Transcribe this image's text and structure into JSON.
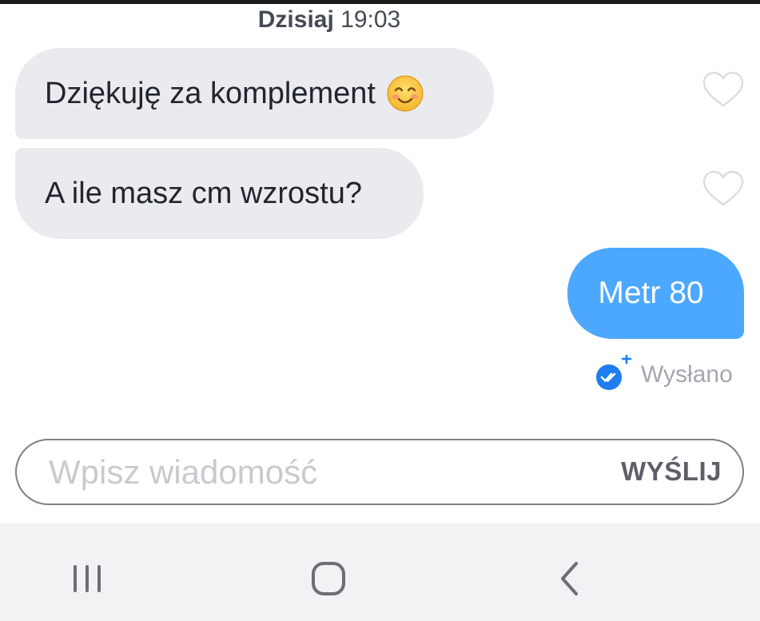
{
  "conversation": {
    "date_label": "Dzisiaj",
    "time_label": "19:03",
    "messages": [
      {
        "direction": "incoming",
        "text": "Dziękuję za komplement",
        "emoji": "smiling-face-icon",
        "liked": false
      },
      {
        "direction": "incoming",
        "text": "A ile masz cm wzrostu?",
        "liked": false
      },
      {
        "direction": "outgoing",
        "text": "Metr 80"
      }
    ],
    "status": {
      "text": "Wysłano",
      "icon": "double-check-icon"
    }
  },
  "composer": {
    "placeholder": "Wpisz wiadomość",
    "value": "",
    "send_label": "WYŚLIJ"
  },
  "nav_bar": {
    "buttons": [
      "recent-apps-icon",
      "home-icon",
      "back-icon"
    ]
  },
  "colors": {
    "incoming_bubble": "#eaebef",
    "outgoing_bubble": "#4ca8ff",
    "status_check": "#1f7df0",
    "nav_background": "#f1f2f4"
  }
}
